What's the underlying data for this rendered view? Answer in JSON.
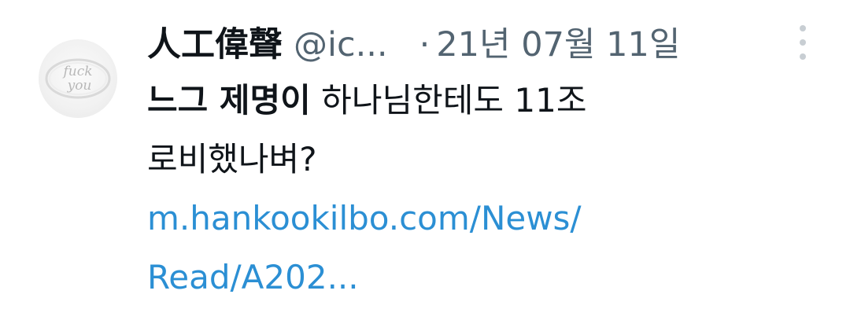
{
  "tweet": {
    "display_name": "人工偉聲",
    "handle": "@ic...",
    "separator": "·",
    "date": "21년 07월 11일",
    "text_bold": "느그 제명이",
    "text_rest": " 하나님한테도 11조",
    "text_line2": "로비했나벼?",
    "link_line1": "m.hankookilbo.com/News/",
    "link_line2": "Read/A202...",
    "avatar_text_top": "fuck",
    "avatar_text_bottom": "you"
  },
  "colors": {
    "text_primary": "#0f1419",
    "text_secondary": "#536471",
    "link": "#2b8fd4"
  },
  "icons": {
    "more": "more-vertical-icon"
  }
}
